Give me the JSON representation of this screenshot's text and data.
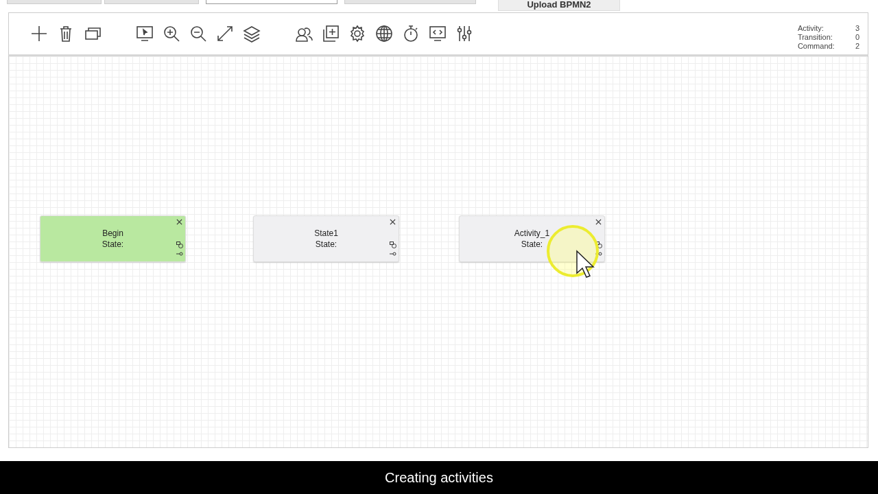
{
  "top_tabs": [
    {
      "selected": false
    },
    {
      "selected": false
    },
    {
      "selected": true
    },
    {
      "selected": false
    }
  ],
  "upload_button": "Upload BPMN2",
  "counters": [
    {
      "label": "Activity:",
      "value": "3"
    },
    {
      "label": "Transition:",
      "value": "0"
    },
    {
      "label": "Command:",
      "value": "2"
    }
  ],
  "nodes": [
    {
      "kind": "begin",
      "name": "Begin",
      "state": "State:"
    },
    {
      "kind": "activity",
      "name": "State1",
      "state": "State:"
    },
    {
      "kind": "activity",
      "name": "Activity_1",
      "state": "State:"
    }
  ],
  "caption": "Creating activities"
}
